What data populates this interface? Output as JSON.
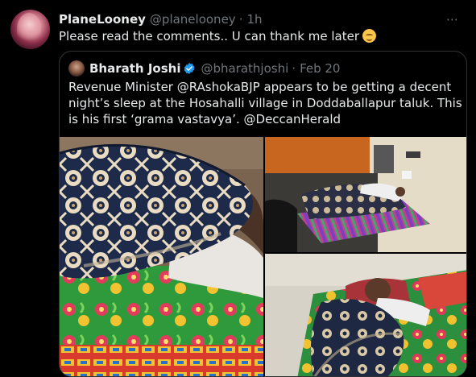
{
  "tweet": {
    "display_name": "PlaneLooney",
    "handle": "@planelooney",
    "separator": "·",
    "time": "1h",
    "text": "Please read the comments.. U can thank me later",
    "emoji": "relieved-face",
    "more_icon": "⋯"
  },
  "quoted_tweet": {
    "display_name": "Bharath Joshi",
    "verified": true,
    "handle": "@bharathjoshi",
    "separator": "·",
    "date": "Feb 20",
    "text": "Revenue Minister @RAshokaBJP appears to be getting a decent night’s sleep at the Hosahalli village in Doddaballapur taluk. This is his first ‘grama vastavya’. @DeccanHerald",
    "photos": [
      {
        "description": "man-sleeping-under-patterned-quilt-closeup"
      },
      {
        "description": "man-sleeping-on-floor-mattress-wide-room"
      },
      {
        "description": "man-sleeping-on-floral-mattress-angle"
      }
    ]
  },
  "colors": {
    "background": "#000000",
    "text_primary": "#e7e9ea",
    "text_secondary": "#71767b",
    "border": "#2f3336",
    "verified_blue": "#1d9bf0"
  }
}
